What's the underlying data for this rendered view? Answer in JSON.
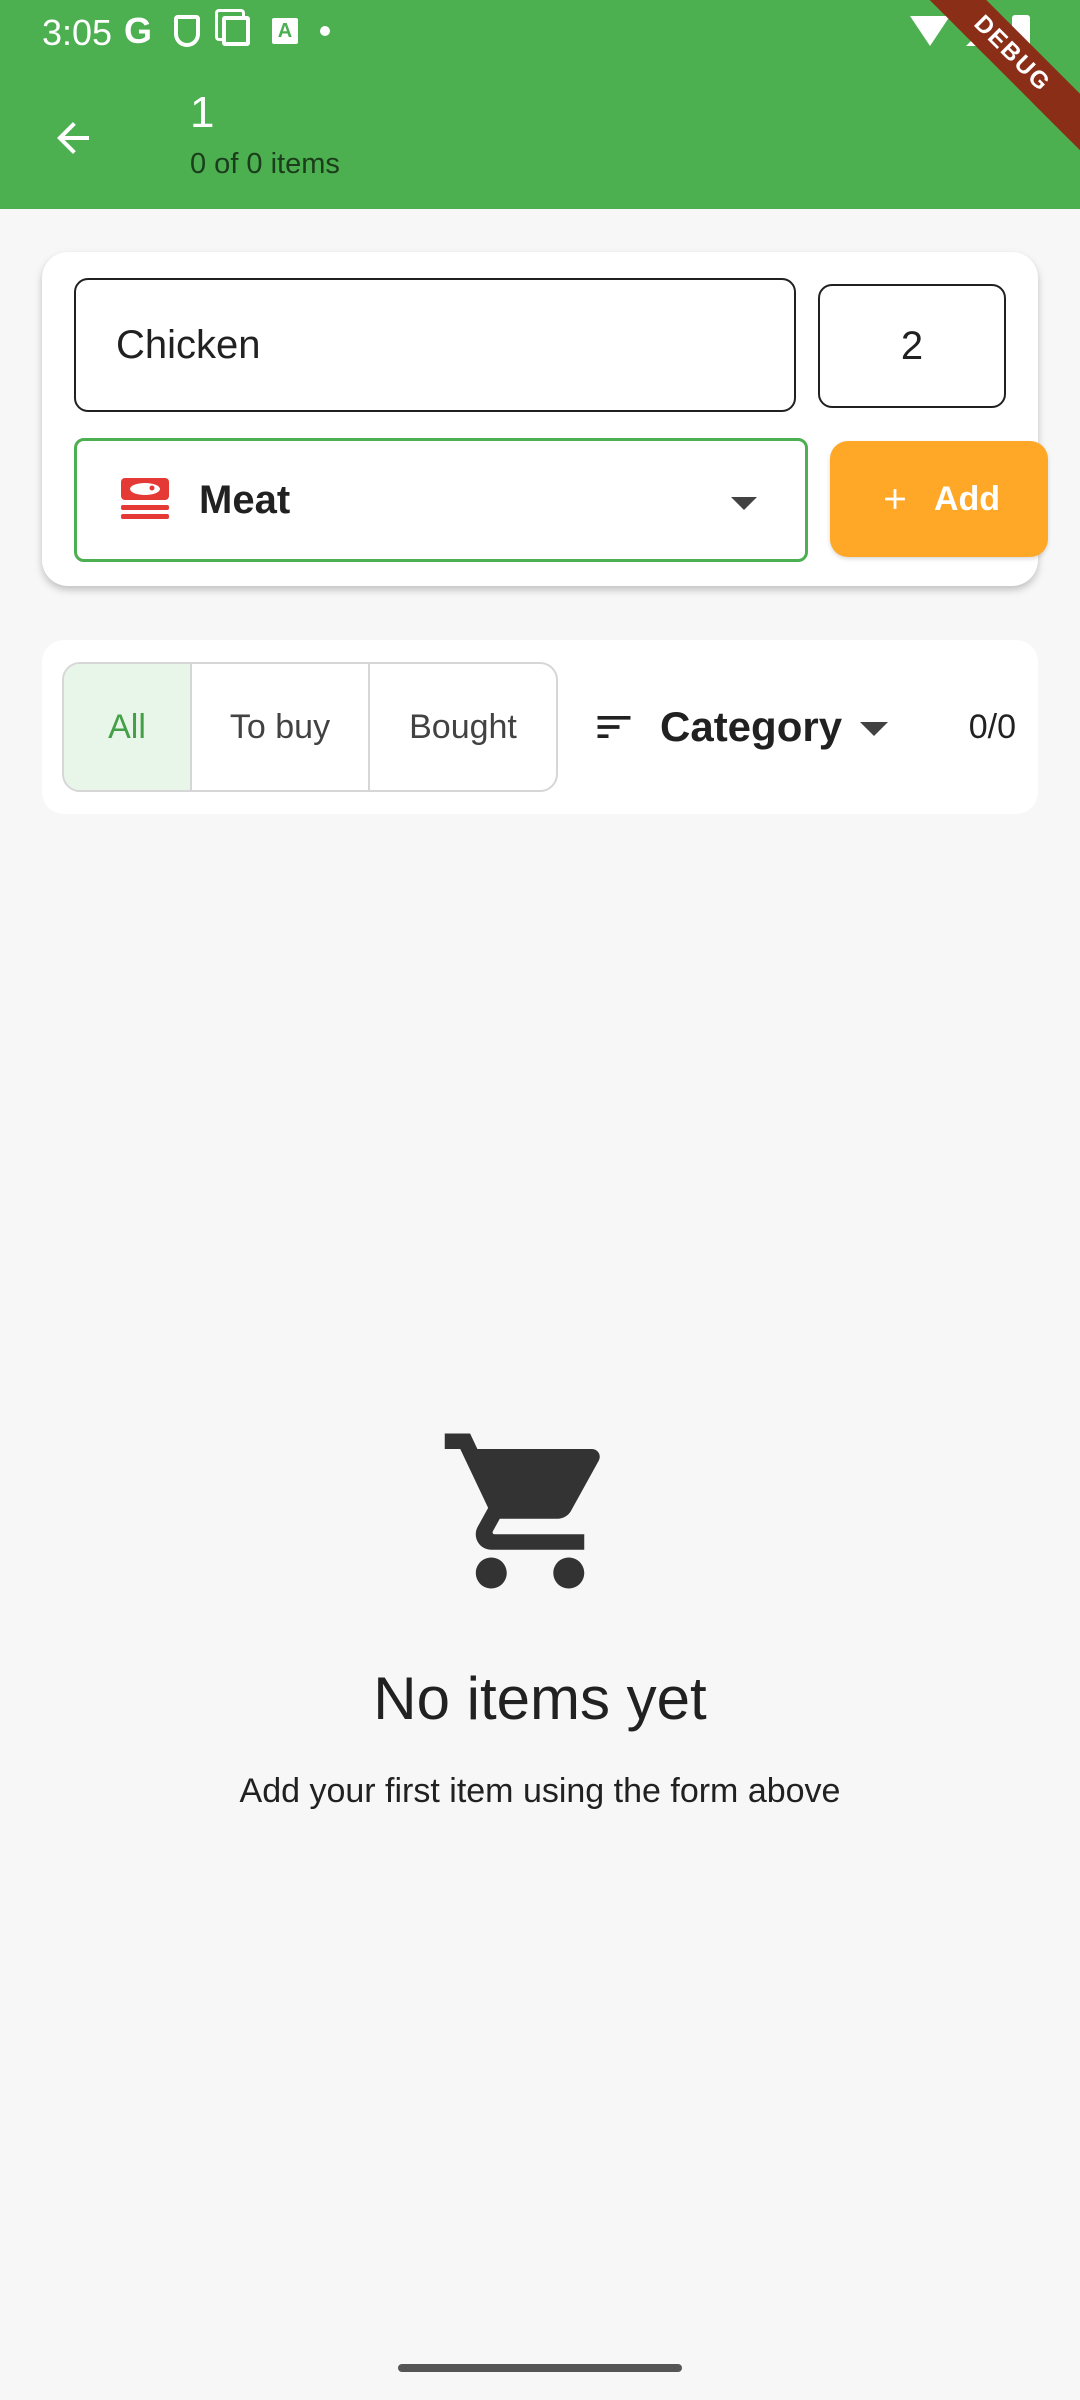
{
  "status_bar": {
    "time": "3:05",
    "g_letter": "G",
    "a_letter": "A"
  },
  "debug_ribbon": "DEBUG",
  "app_bar": {
    "title": "1",
    "subtitle": "0 of 0 items",
    "back_icon": "arrow-back-icon"
  },
  "form": {
    "name_value": "Chicken",
    "quantity_value": "2",
    "category": {
      "label": "Meat",
      "icon": "meat-icon",
      "icon_color": "#e53935"
    },
    "add_button": {
      "label": "Add",
      "icon": "plus-icon",
      "color": "#ffa726"
    }
  },
  "filters": {
    "segments": [
      {
        "label": "All",
        "active": true
      },
      {
        "label": "To buy",
        "active": false
      },
      {
        "label": "Bought",
        "active": false
      }
    ],
    "sort": {
      "label": "Category",
      "icon": "sort-icon"
    },
    "counter": "0/0"
  },
  "empty_state": {
    "icon": "shopping-cart-icon",
    "title": "No items yet",
    "subtitle": "Add your first item using the form above"
  },
  "colors": {
    "primary": "#4caf50",
    "accent": "#ffa726",
    "background": "#f7f7f7"
  }
}
